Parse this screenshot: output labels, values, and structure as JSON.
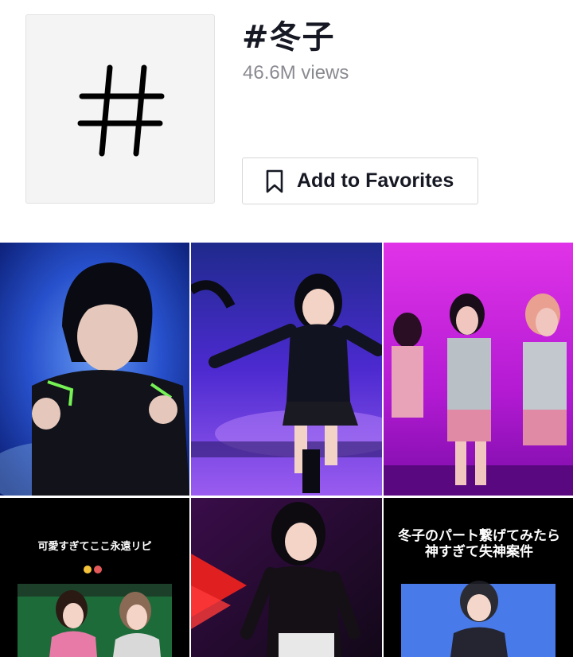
{
  "hashtag": {
    "title": "#冬子",
    "views": "46.6M views",
    "symbol_icon": "hashtag-icon"
  },
  "actions": {
    "favorite_label": "Add to Favorites",
    "favorite_icon": "bookmark-icon"
  },
  "videos": [
    {
      "caption": ""
    },
    {
      "caption": ""
    },
    {
      "caption": ""
    },
    {
      "caption": "可愛すぎてここ永遠リピ"
    },
    {
      "caption": ""
    },
    {
      "caption": "冬子のパート繋げてみたら\n神すぎて失神案件"
    }
  ],
  "colors": {
    "text_primary": "#161823",
    "text_secondary": "#8a8b91",
    "border": "#d6d6d8"
  }
}
